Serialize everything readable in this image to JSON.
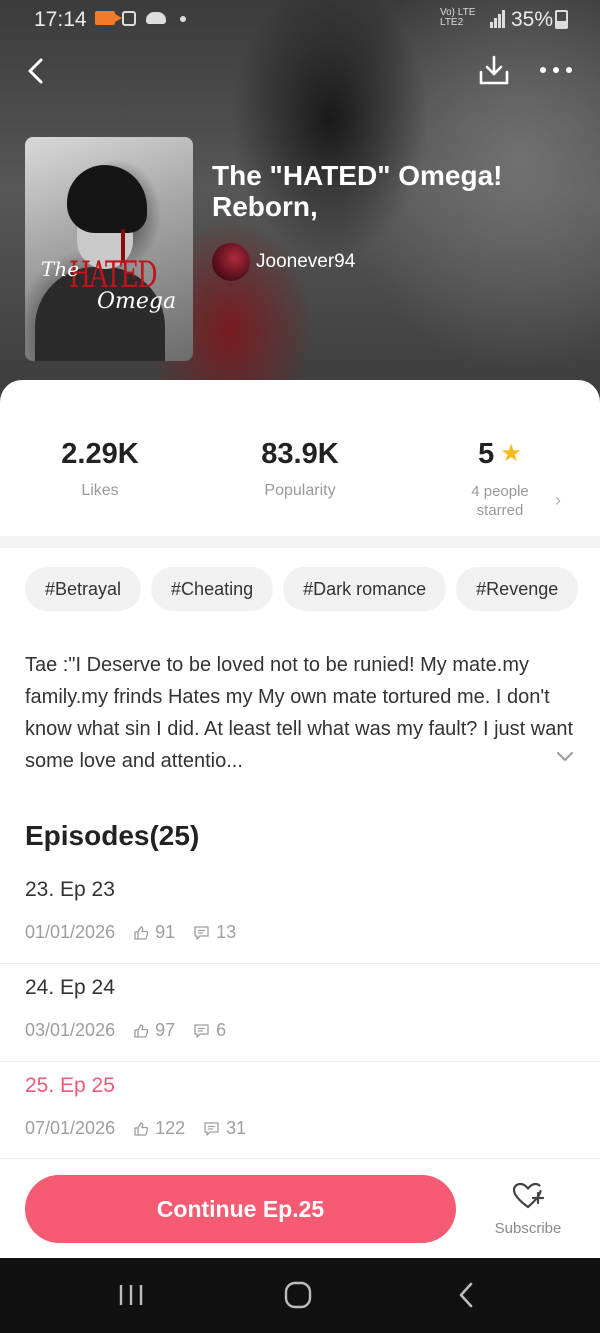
{
  "status_bar": {
    "time": "17:14",
    "network": "Vo) LTE\nLTE2",
    "battery": "35%"
  },
  "book": {
    "title": "The \"HATED\" Omega!\nReborn,",
    "author": "Joonever94",
    "cover_text": {
      "the": "The",
      "hated": "HATED",
      "omega": "Omega"
    }
  },
  "stats": {
    "likes_value": "2.29K",
    "likes_label": "Likes",
    "popularity_value": "83.9K",
    "popularity_label": "Popularity",
    "rating_value": "5",
    "rating_sub_1": "4 people",
    "rating_sub_2": "starred"
  },
  "tags": [
    "#Betrayal",
    "#Cheating",
    "#Dark romance",
    "#Revenge"
  ],
  "synopsis": "Tae :\"I Deserve to be loved not to be runied! My mate.my family.my frinds Hates my My own mate tortured me. I don't know what sin I did. At least tell what was my fault? I just want some love and attentio...",
  "episodes_title": "Episodes(25)",
  "episodes": [
    {
      "title": "23. Ep 23",
      "date": "01/01/2026",
      "likes": "91",
      "comments": "13"
    },
    {
      "title": "24. Ep 24",
      "date": "03/01/2026",
      "likes": "97",
      "comments": "6"
    },
    {
      "title": "25. Ep 25",
      "date": "07/01/2026",
      "likes": "122",
      "comments": "31"
    }
  ],
  "actions": {
    "continue_label": "Continue Ep.25",
    "subscribe_label": "Subscribe"
  },
  "colors": {
    "accent": "#f55c74",
    "current_episode": "#f0597a",
    "star": "#f7b91a"
  }
}
